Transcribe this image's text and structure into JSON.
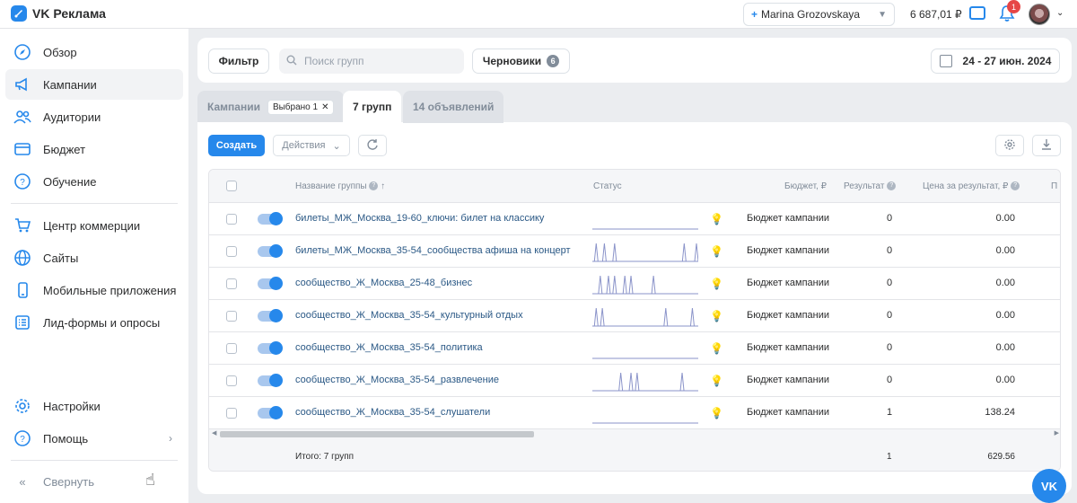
{
  "app": {
    "title": "VK Реклама"
  },
  "header": {
    "account": "Marina Grozovskaya",
    "balance": "6 687,01 ₽",
    "notifications_count": "1"
  },
  "sidebar": {
    "items": [
      {
        "label": "Обзор",
        "icon": "compass-icon"
      },
      {
        "label": "Кампании",
        "icon": "megaphone-icon"
      },
      {
        "label": "Аудитории",
        "icon": "users-icon"
      },
      {
        "label": "Бюджет",
        "icon": "wallet-icon"
      },
      {
        "label": "Обучение",
        "icon": "question-icon"
      },
      {
        "label": "Центр коммерции",
        "icon": "cart-icon"
      },
      {
        "label": "Сайты",
        "icon": "globe-icon"
      },
      {
        "label": "Мобильные приложения",
        "icon": "smartphone-icon"
      },
      {
        "label": "Лид-формы и опросы",
        "icon": "list-icon"
      }
    ],
    "settings": "Настройки",
    "help": "Помощь",
    "collapse": "Свернуть"
  },
  "toolbar": {
    "filter": "Фильтр",
    "search_placeholder": "Поиск групп",
    "drafts": "Черновики",
    "drafts_count": "6",
    "date_range": "24 - 27 июн. 2024"
  },
  "tabs": {
    "campaigns": "Кампании",
    "selected": "Выбрано 1",
    "groups": "7 групп",
    "ads": "14 объявлений"
  },
  "actions": {
    "create": "Создать",
    "actions": "Действия"
  },
  "table": {
    "columns": {
      "name": "Название группы",
      "status": "Статус",
      "budget": "Бюджет, ₽",
      "result": "Результат",
      "price": "Цена за результат, ₽",
      "more": "П"
    },
    "rows": [
      {
        "name": "билеты_МЖ_Москва_19-60_ключи: билет на классику",
        "budget": "Бюджет кампании",
        "result": "0",
        "price": "0.00",
        "spikes": []
      },
      {
        "name": "билеты_МЖ_Москва_35-54_сообщества афиша на концерт",
        "budget": "Бюджет кампании",
        "result": "0",
        "price": "0.00",
        "spikes": [
          0.02,
          0.1,
          0.2,
          0.88,
          1.0
        ]
      },
      {
        "name": "сообщество_Ж_Москва_25-48_бизнес",
        "budget": "Бюджет кампании",
        "result": "0",
        "price": "0.00",
        "spikes": [
          0.06,
          0.14,
          0.2,
          0.3,
          0.36,
          0.58
        ]
      },
      {
        "name": "сообщество_Ж_Москва_35-54_культурный отдых",
        "budget": "Бюджет кампании",
        "result": "0",
        "price": "0.00",
        "spikes": [
          0.02,
          0.08,
          0.7,
          0.96
        ]
      },
      {
        "name": "сообщество_Ж_Москва_35-54_политика",
        "budget": "Бюджет кампании",
        "result": "0",
        "price": "0.00",
        "spikes": []
      },
      {
        "name": "сообщество_Ж_Москва_35-54_развлечение",
        "budget": "Бюджет кампании",
        "result": "0",
        "price": "0.00",
        "spikes": [
          0.26,
          0.36,
          0.42,
          0.86
        ]
      },
      {
        "name": "сообщество_Ж_Москва_35-54_слушатели",
        "budget": "Бюджет кампании",
        "result": "1",
        "price": "138.24",
        "spikes": []
      }
    ],
    "totals": {
      "label": "Итого: 7 групп",
      "result": "1",
      "price": "629.56"
    }
  },
  "colors": {
    "accent": "#2688eb",
    "link": "#2a5885",
    "sparkline": "#8a93c9"
  },
  "fab": {
    "label": "VK"
  }
}
